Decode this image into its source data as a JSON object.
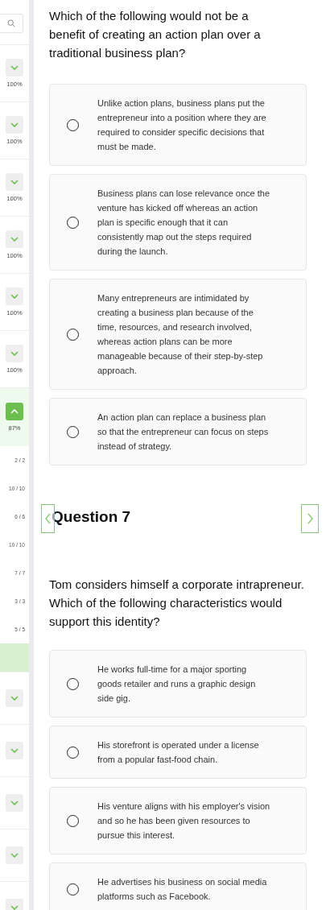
{
  "sidebar": {
    "search": {
      "kind": "search"
    },
    "sections": [
      {
        "percent": "100%",
        "expanded": false
      },
      {
        "percent": "100%",
        "expanded": false
      },
      {
        "percent": "100%",
        "expanded": false
      },
      {
        "percent": "100%",
        "expanded": false
      },
      {
        "percent": "100%",
        "expanded": false
      },
      {
        "percent": "100%",
        "expanded": false
      },
      {
        "percent": "87%",
        "expanded": true,
        "children": [
          {
            "label": "2 / 2",
            "selected": false
          },
          {
            "label": "10 / 10",
            "selected": false
          },
          {
            "label": "6 / 6",
            "selected": false
          },
          {
            "label": "10 / 10",
            "selected": false
          },
          {
            "label": "7 / 7",
            "selected": false
          },
          {
            "label": "3 / 3",
            "selected": false
          },
          {
            "label": "5 / 5",
            "selected": false
          },
          {
            "selected": true
          }
        ]
      },
      {
        "expanded": false
      },
      {
        "expanded": false
      },
      {
        "expanded": false
      },
      {
        "expanded": false
      },
      {
        "expanded": false
      }
    ]
  },
  "questions": [
    {
      "text": "Which of the following would not be a benefit of creating an action plan over a traditional business plan?",
      "options": [
        {
          "text": "Unlike action plans, business plans put the entrepreneur into a position where they are required to consider specific decisions that must be made.",
          "selected": false
        },
        {
          "text": "Business plans can lose relevance once the venture has kicked off whereas an action plan is specific enough that it can consistently map out the steps required during the launch.",
          "selected": false
        },
        {
          "text": "Many entrepreneurs are intimidated by creating a business plan because of the time, resources, and research involved, whereas action plans can be more manageable because of their step-by-step approach.",
          "selected": false
        },
        {
          "text": "An action plan can replace a business plan so that the entrepreneur can focus on steps instead of strategy.",
          "selected": false
        }
      ]
    },
    {
      "heading": "Question 7",
      "text": "Tom considers himself a corporate intrapreneur. Which of the following characteristics would support this identity?",
      "options": [
        {
          "text": "He works full-time for a major sporting goods retailer and runs a graphic design side gig.",
          "selected": false
        },
        {
          "text": "His storefront is operated under a license from a popular fast-food chain.",
          "selected": false
        },
        {
          "text": "His venture aligns with his employer's vision and so he has been given resources to pursue this interest.",
          "selected": false
        },
        {
          "text": "He advertises his business on social media platforms such as Facebook.",
          "selected": false
        }
      ]
    }
  ]
}
